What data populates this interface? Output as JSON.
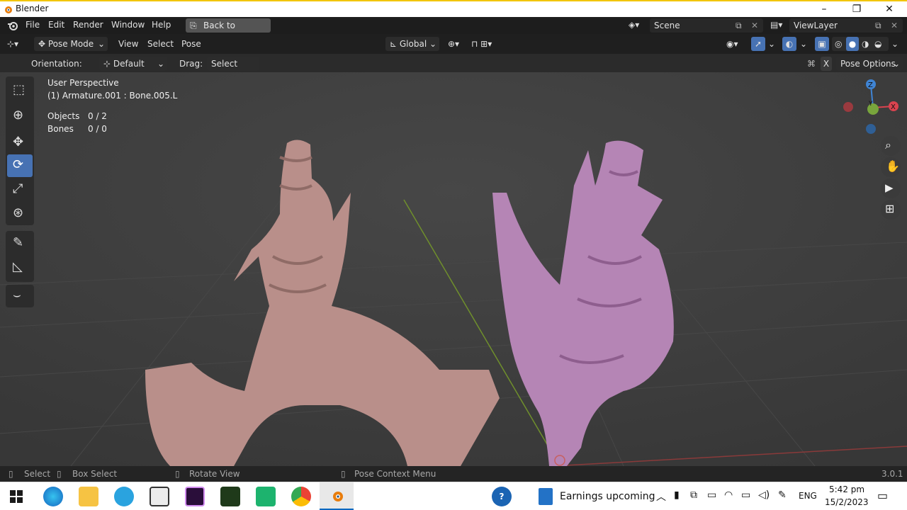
{
  "window": {
    "title": "Blender",
    "controls": [
      "–",
      "❐",
      "✕"
    ]
  },
  "menubar": {
    "items": [
      "File",
      "Edit",
      "Render",
      "Window",
      "Help"
    ],
    "back_button": "Back to Previous",
    "scene_label": "Scene",
    "viewlayer_label": "ViewLayer"
  },
  "header": {
    "mode": "Pose Mode",
    "menus": [
      "View",
      "Select",
      "Pose"
    ],
    "transform_orientation": "Global"
  },
  "tool_options": {
    "orientation_label": "Orientation:",
    "orientation_value": "Default",
    "drag_label": "Drag:",
    "drag_value": "Select Box",
    "pose_options": "Pose Options"
  },
  "viewport": {
    "perspective": "User Perspective",
    "active": "(1) Armature.001 : Bone.005.L",
    "stats": [
      {
        "label": "Objects",
        "value": "0 / 2"
      },
      {
        "label": "Bones",
        "value": "0 / 0"
      }
    ],
    "gizmo_axes": {
      "z": "Z",
      "y": "Y",
      "x": "X"
    }
  },
  "statusbar": {
    "select": "Select",
    "box_select": "Box Select",
    "rotate_view": "Rotate View",
    "context_menu": "Pose Context Menu",
    "version": "3.0.1"
  },
  "taskbar": {
    "notification": "Earnings upcoming",
    "language": "ENG",
    "time": "5:42 pm",
    "date": "15/2/2023"
  },
  "colors": {
    "active_tool": "#4772b3",
    "dragon_left": "#b98f8a",
    "dragon_right": "#b585b5",
    "axis_x": "#d9434f",
    "axis_y": "#78a53c",
    "axis_z": "#3f84d4"
  }
}
